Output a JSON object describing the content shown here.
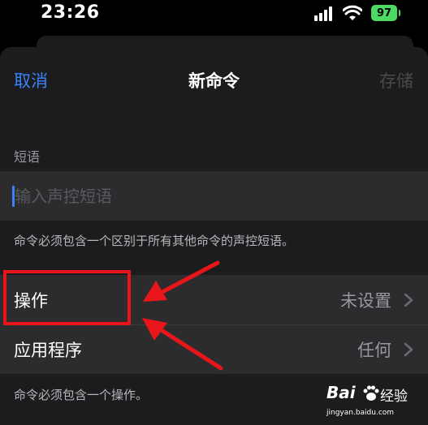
{
  "status_bar": {
    "time": "23:26",
    "battery": "97",
    "icons": [
      "signal-icon",
      "wifi-icon",
      "battery-icon"
    ]
  },
  "nav": {
    "cancel_label": "取消",
    "title": "新命令",
    "save_label": "存储"
  },
  "phrase": {
    "section_label": "短语",
    "placeholder": "输入声控短语",
    "value": "",
    "footnote": "命令必须包含一个区别于所有其他命令的声控短语。"
  },
  "settings": {
    "rows": [
      {
        "label": "操作",
        "value": "未设置",
        "icon": "chevron-right-icon"
      },
      {
        "label": "应用程序",
        "value": "任何",
        "icon": "chevron-right-icon"
      }
    ],
    "footnote": "命令必须包含一个操作。"
  },
  "watermark": {
    "brand_latin": "Bai",
    "brand_cn": "经验",
    "url": "jingyan.baidu.com"
  },
  "colors": {
    "accent": "#3a82f7",
    "annotation": "#e8161b",
    "battery": "#4cd964"
  }
}
